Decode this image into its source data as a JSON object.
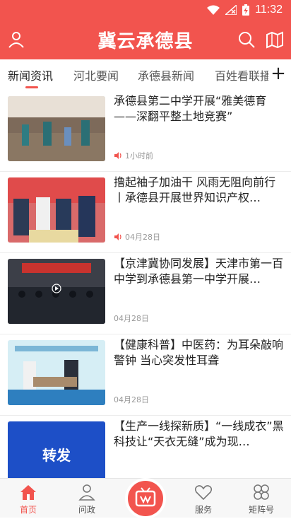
{
  "status_bar": {
    "time": "11:32"
  },
  "app_bar": {
    "title": "冀云承德县",
    "profile_icon": "person-icon",
    "search_icon": "search-icon",
    "map_icon": "map-icon"
  },
  "tabs": [
    {
      "label": "新闻资讯",
      "active": true
    },
    {
      "label": "河北要闻",
      "active": false
    },
    {
      "label": "承德县新闻",
      "active": false
    },
    {
      "label": "百姓看联播",
      "active": false
    }
  ],
  "tabs_more_icon": "plus-icon",
  "feed": [
    {
      "title": "承德县第二中学开展“雅美德育——深翻平整土地竞赛”",
      "meta": "1小时前",
      "audio": true
    },
    {
      "title": "撸起袖子加油干 风雨无阻向前行丨承德县开展世界知识产权…",
      "meta": "04月28日",
      "audio": true
    },
    {
      "title": "【京津冀协同发展】天津市第一百中学到承德县第一中学开展…",
      "meta": "04月28日",
      "audio": false
    },
    {
      "title": "【健康科普】中医药：为耳朵敲响警钟 当心突发性耳聋",
      "meta": "04月28日",
      "audio": false
    },
    {
      "title": "【生产一线探新质】“一线成衣”黑科技让“天衣无缝”成为现…",
      "meta": "",
      "audio": false,
      "thumb_text": "转发"
    }
  ],
  "bottom_tabs": [
    {
      "label": "首页",
      "active": true,
      "icon": "home-icon"
    },
    {
      "label": "问政",
      "active": false,
      "icon": "user-icon"
    },
    {
      "label": "服务",
      "active": false,
      "icon": "heart-icon"
    },
    {
      "label": "矩阵号",
      "active": false,
      "icon": "grid-icon"
    }
  ],
  "center_button_icon": "tv-icon",
  "colors": {
    "brand": "#f2544e"
  }
}
